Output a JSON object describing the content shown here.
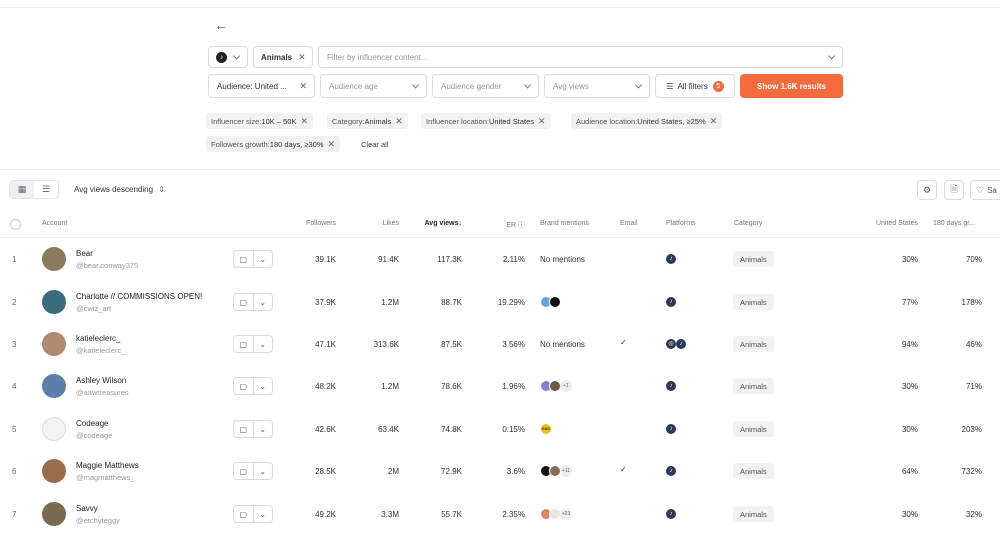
{
  "nav": {
    "back_icon": "arrow-left-icon",
    "back_glyph": "←"
  },
  "filters": {
    "platform_icon": "tiktok-icon",
    "category_chip": "Animals",
    "search_placeholder": "Filter by influencer content...",
    "audience_location": "Audience: United ...",
    "audience_age_placeholder": "Audience age",
    "audience_gender_placeholder": "Audience gender",
    "avg_views_placeholder": "Avg views",
    "all_filters_label": "All filters",
    "all_filters_count": "5",
    "show_results_label": "Show 1.6K results"
  },
  "active_filters": [
    {
      "key": "Influencer size: ",
      "value": "10K – 50K"
    },
    {
      "key": "Category: ",
      "value": "Animals"
    },
    {
      "key": "Influencer location: ",
      "value": "United States"
    },
    {
      "key": "Audience location: ",
      "value": "United States, ≥25%"
    },
    {
      "key": "Followers growth: ",
      "value": "180 days, ≥30%"
    }
  ],
  "clear_all_label": "Clear all",
  "toolbar": {
    "sort_label": "Avg views descending",
    "save_label": "Sa"
  },
  "table": {
    "headers": {
      "account": "Account",
      "followers": "Followers",
      "likes": "Likes",
      "avg_views": "Avg views",
      "er": "ER",
      "brand_mentions": "Brand mentions",
      "email": "Email",
      "platforms": "Platforms",
      "category": "Category",
      "united_states": "United States",
      "growth": "180 days gr..."
    },
    "rows": [
      {
        "index": "1",
        "name": "Bear",
        "handle": "@bear.conway375",
        "followers": "39.1K",
        "likes": "91.4K",
        "avg_views": "117.3K",
        "er": "2.11%",
        "brand_mentions": "No mentions",
        "email": "",
        "category": "Animals",
        "us": "30%",
        "growth": "70%",
        "avatar_color": "#8a7a5e"
      },
      {
        "index": "2",
        "name": "Charlotte // COMMISSIONS OPEN!",
        "handle": "@cwiz_art",
        "followers": "37.9K",
        "likes": "1.2M",
        "avg_views": "88.7K",
        "er": "19.29%",
        "brand_mentions": "",
        "email": "",
        "category": "Animals",
        "us": "77%",
        "growth": "178%",
        "avatar_color": "#3a6d7c"
      },
      {
        "index": "3",
        "name": "katieleclerc_",
        "handle": "@katieleclerc_",
        "followers": "47.1K",
        "likes": "313.6K",
        "avg_views": "87.5K",
        "er": "3.56%",
        "brand_mentions": "No mentions",
        "email": "✓",
        "category": "Animals",
        "us": "94%",
        "growth": "46%",
        "avatar_color": "#b08a70"
      },
      {
        "index": "4",
        "name": "Ashley Wilson",
        "handle": "@aawtreasures",
        "followers": "48.2K",
        "likes": "1.2M",
        "avg_views": "78.6K",
        "er": "1.96%",
        "brand_mentions": "",
        "email": "",
        "category": "Animals",
        "us": "30%",
        "growth": "71%",
        "avatar_color": "#5b7fa8"
      },
      {
        "index": "5",
        "name": "Codeage",
        "handle": "@codeage",
        "followers": "42.6K",
        "likes": "63.4K",
        "avg_views": "74.8K",
        "er": "0.15%",
        "brand_mentions": "",
        "email": "",
        "category": "Animals",
        "us": "30%",
        "growth": "203%",
        "avatar_color": "#f3f3f3"
      },
      {
        "index": "6",
        "name": "Maggie Matthews",
        "handle": "@magmatthews_",
        "followers": "28.5K",
        "likes": "2M",
        "avg_views": "72.9K",
        "er": "3.6%",
        "brand_mentions": "",
        "email": "✓",
        "category": "Animals",
        "us": "64%",
        "growth": "732%",
        "avatar_color": "#9b6b4e"
      },
      {
        "index": "7",
        "name": "Savvy",
        "handle": "@etchyteggy",
        "followers": "49.2K",
        "likes": "3.3M",
        "avg_views": "55.7K",
        "er": "2.35%",
        "brand_mentions": "",
        "email": "",
        "category": "Animals",
        "us": "30%",
        "growth": "32%",
        "avatar_color": "#7b6a52"
      }
    ],
    "mentions": {
      "row4_more": "+1",
      "row5_label": "GNC",
      "row6_more": "+11",
      "row7_more": "+23"
    }
  }
}
